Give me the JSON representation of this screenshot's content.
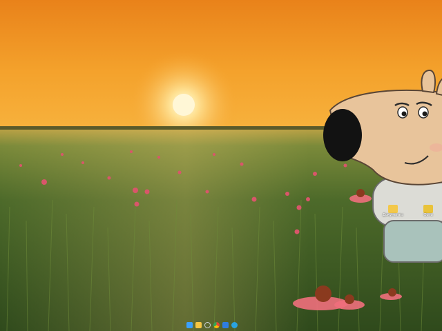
{
  "desktop": {
    "icons": [
      {
        "label": "Документы",
        "icon": "folder-icon",
        "color": "#f3c84a"
      },
      {
        "label": "Фото",
        "icon": "photos-icon",
        "color": "#e9c33a"
      }
    ]
  },
  "taskbar": {
    "items": [
      {
        "name": "start",
        "icon": "windows-start-icon",
        "color": "#3aa0ff"
      },
      {
        "name": "file-explorer",
        "icon": "folder-icon",
        "color": "#f4c542"
      },
      {
        "name": "search",
        "icon": "search-icon",
        "color": "#cfd6de"
      },
      {
        "name": "chrome",
        "icon": "chrome-icon",
        "color": "#ea4335"
      },
      {
        "name": "app",
        "icon": "app-icon",
        "color": "#2f7de1"
      },
      {
        "name": "telegram",
        "icon": "telegram-icon",
        "color": "#2aa3e0"
      }
    ]
  },
  "colors": {
    "sky_top": "#f08a1d",
    "sun": "#fff6c8",
    "grass": "#4d6d2a",
    "character": "#e7c49b"
  }
}
